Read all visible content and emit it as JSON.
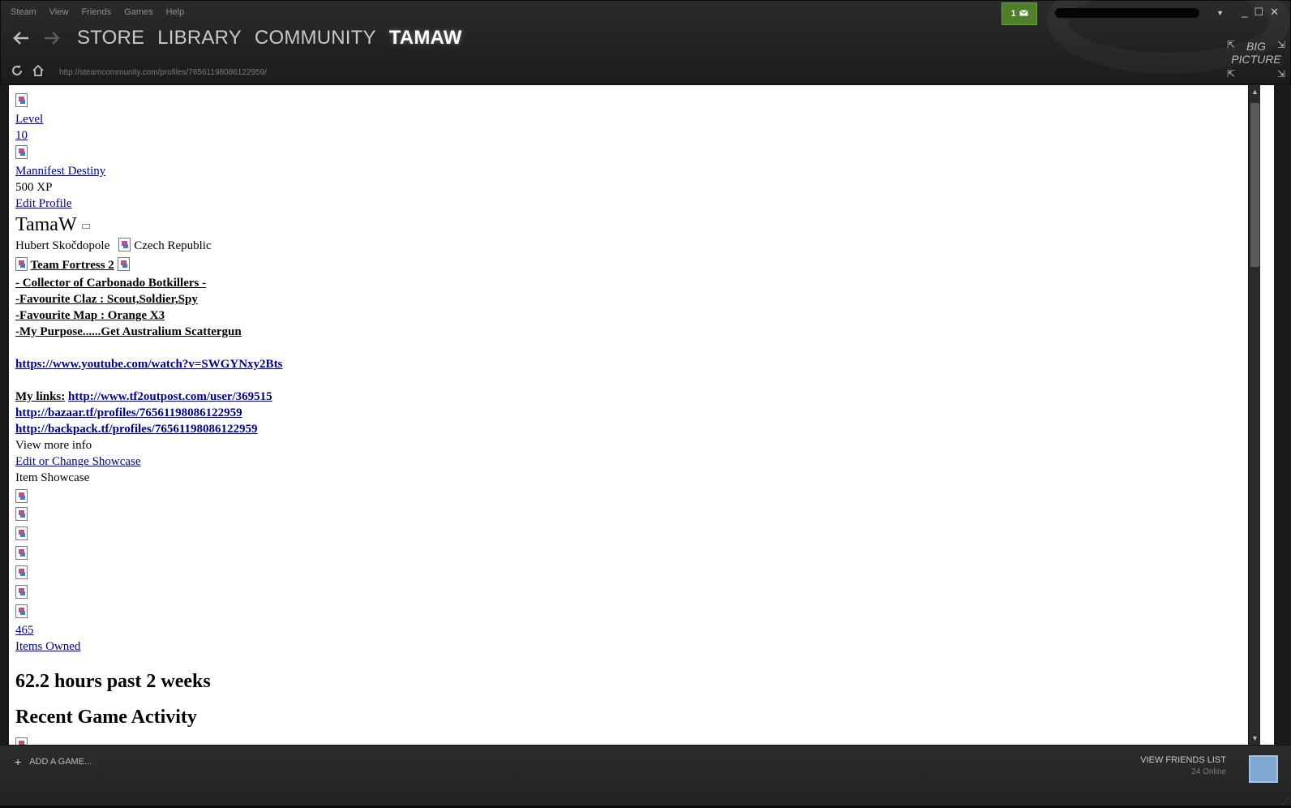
{
  "menu": [
    "Steam",
    "View",
    "Friends",
    "Games",
    "Help"
  ],
  "nav": {
    "store": "STORE",
    "library": "LIBRARY",
    "community": "COMMUNITY",
    "user": "TAMAW"
  },
  "url": "http://steamcommunity.com/profiles/76561198086122959/",
  "inbox_count": "1",
  "big_picture": {
    "line1": "BIG",
    "line2": "PICTURE"
  },
  "profile": {
    "level_label": "Level",
    "level_value": "10",
    "badge_name": "Mannifest Destiny",
    "badge_xp": "500 XP",
    "edit_profile": "Edit Profile",
    "persona_name": "TamaW",
    "real_name": "Hubert Skočdopole",
    "country": "Czech Republic",
    "game_title": "Team Fortress 2",
    "summary_lines": [
      "- Collector of Carbonado Botkillers -",
      "-Favourite Claz : Scout,Soldier,Spy",
      "-Favourite Map : Orange X3",
      "-My Purpose......Get Australium Scattergun"
    ],
    "youtube_link": "https://www.youtube.com/watch?v=SWGYNxy2Bts",
    "my_links_label": "My links:",
    "links": [
      "http://www.tf2outpost.com/user/369515",
      "http://bazaar.tf/profiles/76561198086122959",
      "http://backpack.tf/profiles/76561198086122959"
    ],
    "view_more": "View more info",
    "edit_showcase": "Edit or Change Showcase",
    "showcase_title": "Item Showcase",
    "items_count": "465",
    "items_owned": "Items Owned",
    "hours": "62.2 hours past 2 weeks",
    "recent_activity": "Recent Game Activity"
  },
  "bottom": {
    "add_game": "ADD A GAME...",
    "view_friends": "VIEW FRIENDS LIST",
    "online": "24 Online"
  }
}
